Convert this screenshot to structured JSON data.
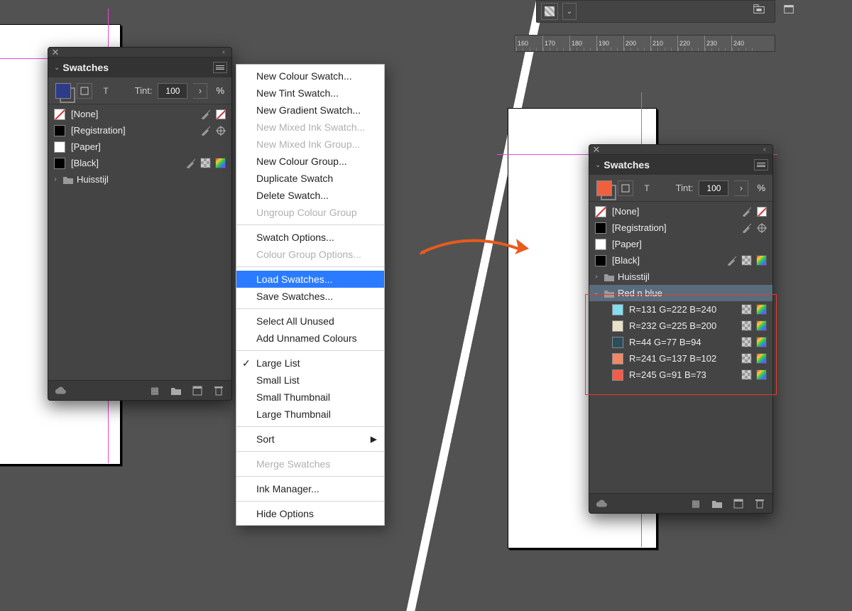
{
  "ruler_values": [
    "160",
    "170",
    "180",
    "190",
    "200",
    "210",
    "220",
    "230",
    "240"
  ],
  "panel_title": "Swatches",
  "tint": {
    "label": "Tint:",
    "value": "100",
    "unit": "%"
  },
  "left_panel": {
    "fill_color": "#2d3b88",
    "swatches": [
      {
        "name": "[None]",
        "chip_class": "none-slash",
        "icons": [
          "noedit",
          "noneslash"
        ]
      },
      {
        "name": "[Registration]",
        "chip_color": "#000",
        "icons": [
          "noedit",
          "registration"
        ]
      },
      {
        "name": "[Paper]",
        "chip_color": "#fff",
        "icons": []
      },
      {
        "name": "[Black]",
        "chip_color": "#000",
        "icons": [
          "noedit",
          "checker",
          "rainbow"
        ]
      }
    ],
    "groups": [
      {
        "name": "Huisstijl",
        "open": false
      }
    ]
  },
  "right_panel": {
    "fill_color": "#f0603f",
    "swatches": [
      {
        "name": "[None]",
        "chip_class": "none-slash",
        "icons": [
          "noedit",
          "noneslash"
        ]
      },
      {
        "name": "[Registration]",
        "chip_color": "#000",
        "icons": [
          "noedit",
          "registration"
        ]
      },
      {
        "name": "[Paper]",
        "chip_color": "#fff",
        "icons": []
      },
      {
        "name": "[Black]",
        "chip_color": "#000",
        "icons": [
          "noedit",
          "checker",
          "rainbow"
        ]
      }
    ],
    "groups": [
      {
        "name": "Huisstijl",
        "open": false
      },
      {
        "name": "Red n blue",
        "open": true,
        "selected": true
      }
    ],
    "group_swatches": [
      {
        "name": "R=131 G=222 B=240",
        "chip_color": "#83def0"
      },
      {
        "name": "R=232 G=225 B=200",
        "chip_color": "#e8e1c8"
      },
      {
        "name": "R=44 G=77 B=94",
        "chip_color": "#2c4d5e"
      },
      {
        "name": "R=241 G=137 B=102",
        "chip_color": "#f18966"
      },
      {
        "name": "R=245 G=91 B=73",
        "chip_color": "#f55b49"
      }
    ]
  },
  "flyout": [
    {
      "label": "New Colour Swatch..."
    },
    {
      "label": "New Tint Swatch..."
    },
    {
      "label": "New Gradient Swatch..."
    },
    {
      "label": "New Mixed Ink Swatch...",
      "disabled": true
    },
    {
      "label": "New Mixed Ink Group...",
      "disabled": true
    },
    {
      "label": "New Colour Group..."
    },
    {
      "label": "Duplicate Swatch"
    },
    {
      "label": "Delete Swatch..."
    },
    {
      "label": "Ungroup Colour Group",
      "disabled": true
    },
    {
      "sep": true
    },
    {
      "label": "Swatch Options..."
    },
    {
      "label": "Colour Group Options...",
      "disabled": true
    },
    {
      "sep": true
    },
    {
      "label": "Load Swatches...",
      "highlight": true
    },
    {
      "label": "Save Swatches..."
    },
    {
      "sep": true
    },
    {
      "label": "Select All Unused"
    },
    {
      "label": "Add Unnamed Colours"
    },
    {
      "sep": true
    },
    {
      "label": "Large List",
      "checked": true
    },
    {
      "label": "Small List"
    },
    {
      "label": "Small Thumbnail"
    },
    {
      "label": "Large Thumbnail"
    },
    {
      "sep": true
    },
    {
      "label": "Sort",
      "submenu": true
    },
    {
      "sep": true
    },
    {
      "label": "Merge Swatches",
      "disabled": true
    },
    {
      "sep": true
    },
    {
      "label": "Ink Manager..."
    },
    {
      "sep": true
    },
    {
      "label": "Hide Options"
    }
  ]
}
